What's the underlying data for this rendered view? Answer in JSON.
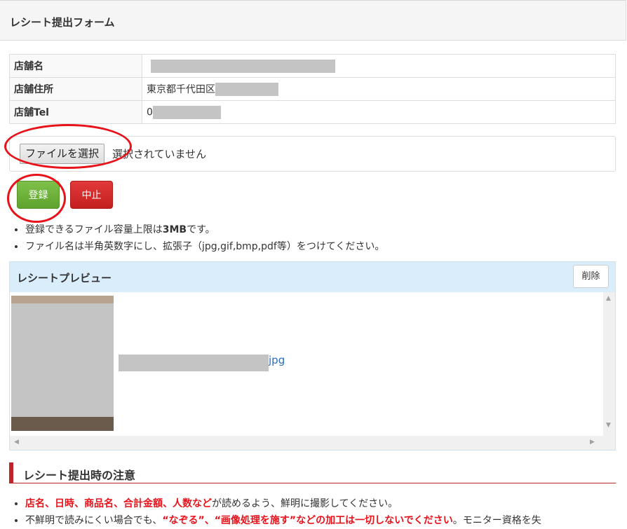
{
  "header": {
    "title": "レシート提出フォーム"
  },
  "store_table": [
    {
      "key": "店舗名",
      "value": ""
    },
    {
      "key": "店舗住所",
      "value": "東京都千代田区"
    },
    {
      "key": "店舗Tel",
      "value": "0"
    }
  ],
  "file_input": {
    "button_label": "ファイルを選択",
    "status": "選択されていません"
  },
  "buttons": {
    "register": "登録",
    "cancel": "中止"
  },
  "notes": [
    {
      "pre": "登録できるファイル容量上限は",
      "bold": "3MB",
      "post": "です。"
    },
    {
      "text": "ファイル名は半角英数字にし、拡張子（jpg,gif,bmp,pdf等）をつけてください。"
    }
  ],
  "preview": {
    "title": "レシートプレビュー",
    "delete_label": "削除",
    "file_ext": "jpg"
  },
  "caution": {
    "title": "レシート提出時の注意",
    "item1": {
      "red": "店名、日時、商品名、合計金額、人数など",
      "rest": "が読めるよう、鮮明に撮影してください。"
    },
    "item2": {
      "pre": "不鮮明で読みにくい場合でも、",
      "red": "“なぞる”、“画像処理を施す”などの加工は一切しないでください",
      "post": "。モニター資格を失"
    }
  },
  "colors": {
    "accent_red": "#e8121b",
    "register_green": "#6ab13a",
    "cancel_red": "#d42b2b",
    "preview_header": "#d9edfb",
    "link_blue": "#2a6bbf"
  }
}
